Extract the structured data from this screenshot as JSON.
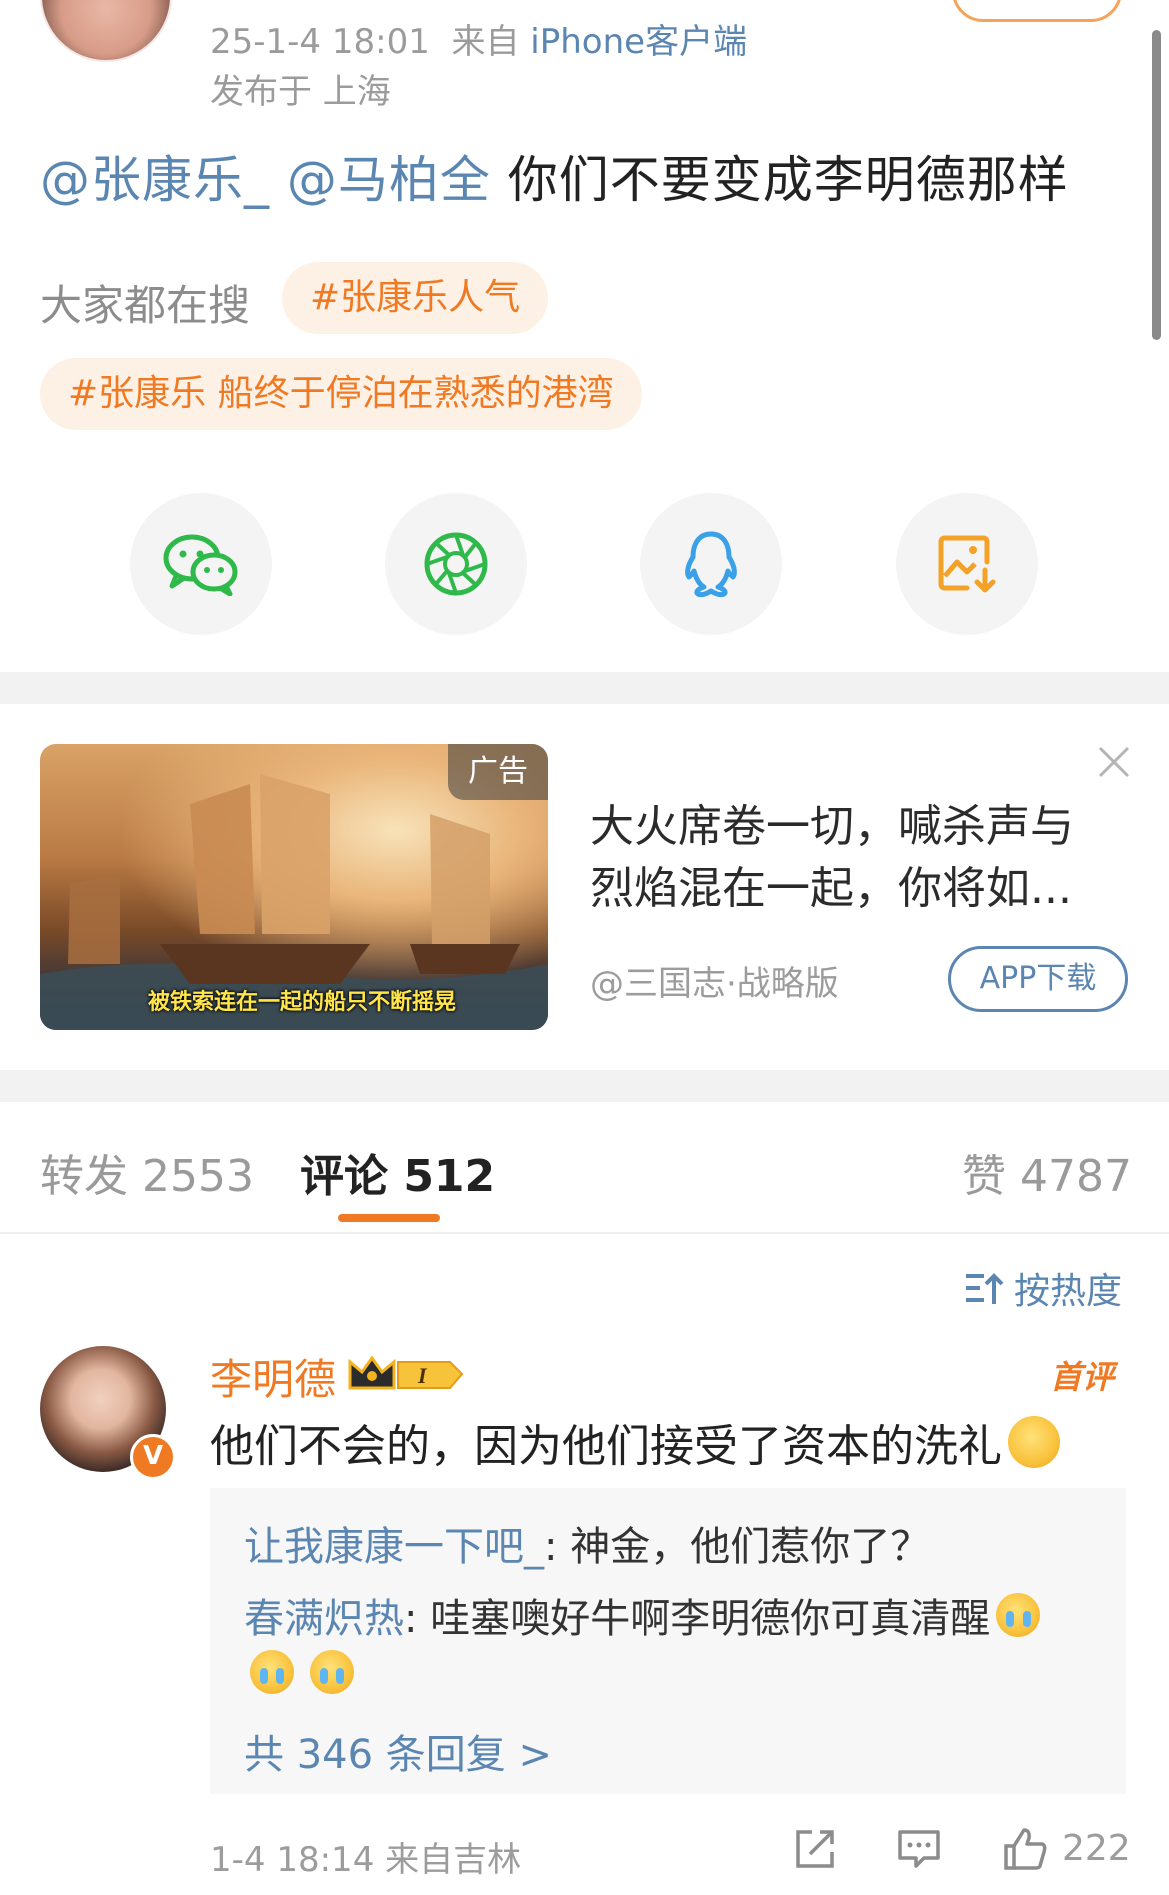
{
  "post": {
    "meta_time": "25-1-4 18:01",
    "meta_from": "来自",
    "meta_client": "iPhone客户端",
    "location": "发布于 上海",
    "mention1": "@张康乐_",
    "mention2": "@马柏全",
    "text": " 你们不要变成李明德那样"
  },
  "search": {
    "label": "大家都在搜",
    "tags": [
      "#张康乐人气",
      "#张康乐 船终于停泊在熟悉的港湾"
    ]
  },
  "share": {
    "icons": [
      "wechat-icon",
      "moments-icon",
      "qq-icon",
      "save-image-icon"
    ]
  },
  "ad": {
    "badge": "广告",
    "caption": "被铁索连在一起的船只不断摇晃",
    "title": "大火席卷一切，喊杀声与烈焰混在一起，你将如...",
    "source": "@三国志·战略版",
    "download": "APP下载"
  },
  "tabs": {
    "repost": "转发 2553",
    "comment": "评论 512",
    "like": "赞 4787"
  },
  "sort": {
    "label": "按热度"
  },
  "comment": {
    "name": "李明德",
    "first_badge": "首评",
    "text": "他们不会的，因为他们接受了资本的洗礼",
    "verified": "V",
    "replies": [
      {
        "user": "让我康康一下吧_",
        "text": ": 神金，他们惹你了？"
      },
      {
        "user": "春满炽热",
        "text": ": 哇塞噢好牛啊李明德你可真清醒"
      }
    ],
    "total_replies": "共 346 条回复 >",
    "meta": "1-4 18:14  来自吉林",
    "likes": "222"
  },
  "colors": {
    "accent": "#f07a23",
    "link": "#5b86b2",
    "wechat": "#2fb94a",
    "qq": "#3aa0e8",
    "save": "#f3a227"
  }
}
